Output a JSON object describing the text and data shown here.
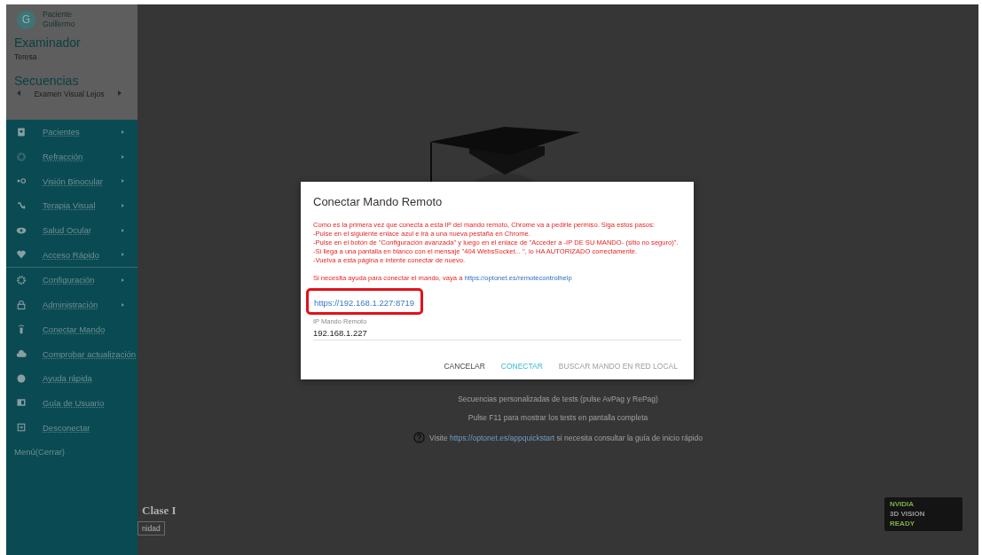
{
  "sidebar": {
    "patient": {
      "avatar": "G",
      "label": "Paciente",
      "name": "Guillermo"
    },
    "examiner": {
      "title": "Examinador",
      "name": "Teresa"
    },
    "sequences": {
      "title": "Secuencias",
      "current": "Examen Visual Lejos"
    },
    "sections": [
      {
        "items": [
          {
            "label": "Pacientes",
            "submenu": true
          },
          {
            "label": "Refracción",
            "submenu": true
          },
          {
            "label": "Visión Binocular",
            "submenu": true
          },
          {
            "label": "Terapia Visual",
            "submenu": true
          },
          {
            "label": "Salud Ocular",
            "submenu": true
          },
          {
            "label": "Acceso Rápido",
            "submenu": true
          }
        ]
      },
      {
        "items": [
          {
            "label": "Configuración",
            "submenu": true
          },
          {
            "label": "Administración",
            "submenu": true
          },
          {
            "label": "Conectar Mando",
            "submenu": false
          },
          {
            "label": "Comprobar actualización",
            "submenu": false
          },
          {
            "label": "Ayuda rápida",
            "submenu": false
          },
          {
            "label": "Guía de Usuario",
            "submenu": false
          },
          {
            "label": "Desconectar",
            "submenu": false
          }
        ]
      }
    ],
    "close": "Menú(Cerrar)"
  },
  "main": {
    "lines": [
      "Secuencias personalizadas de tests (pulse AvPag y RePag)",
      "Pulse F11 para mostrar los tests en pantalla completa"
    ],
    "quickstart": {
      "before": "Visite ",
      "link": "https://optonet.es/appquickstart",
      "after": " si necesita consultar la guía de inicio rápido"
    },
    "heading": "Clase I",
    "button": "nidad",
    "badge": {
      "brand": "NVIDIA",
      "line1": "3D VISION",
      "line2": "READY"
    }
  },
  "dialog": {
    "title": "Conectar Mando Remoto",
    "instructions": [
      "Como es la primera vez que conecta a esta IP del mando remoto, Chrome va a pedirle permiso. Siga estos pasos:",
      "-Pulse en el siguiente enlace azul e irá a una nueva pestaña en Chrome.",
      "-Pulse en el botón de \"Configuración avanzada\" y luego en el enlace de \"Acceder a -IP DE SU MANDO- (sitio no seguro)\".",
      "-Si llega a una pantalla en blanco con el mensaje \"404 WebsSocket... \", lo HA AUTORIZADO correctamente.",
      "-Vuelva a esta página e intente conectar de nuevo."
    ],
    "help": {
      "text": "Si necesita ayuda para conectar el mando, vaya a ",
      "link": "https://optonet.es/remotecontrolhelp"
    },
    "remote_link": "https://192.168.1.227:8719",
    "ip_field": {
      "label": "IP Mando Remoto",
      "value": "192.168.1.227"
    },
    "buttons": [
      {
        "label": "CANCELAR",
        "kind": "plain"
      },
      {
        "label": "CONECTAR",
        "kind": "primary"
      },
      {
        "label": "BUSCAR MANDO EN RED LOCAL",
        "kind": "disabled"
      }
    ]
  }
}
